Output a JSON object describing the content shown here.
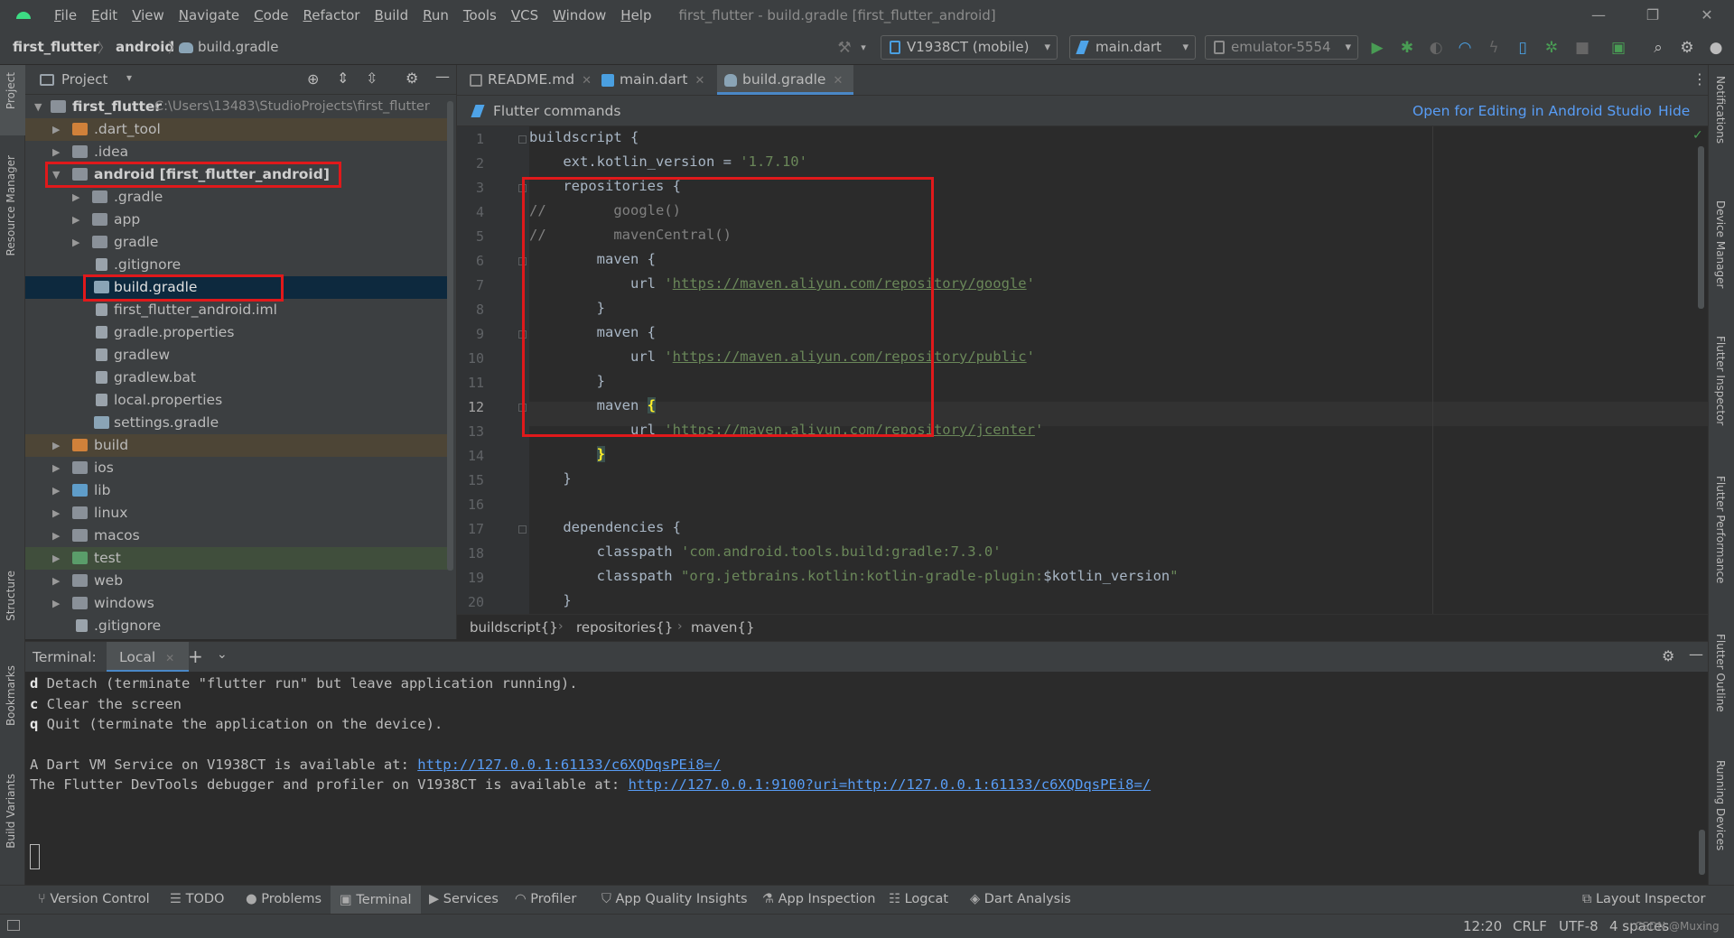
{
  "menubar": {
    "items": [
      "File",
      "Edit",
      "View",
      "Navigate",
      "Code",
      "Refactor",
      "Build",
      "Run",
      "Tools",
      "VCS",
      "Window",
      "Help"
    ],
    "window_title": "first_flutter - build.gradle [first_flutter_android]"
  },
  "navbar": {
    "breadcrumbs": [
      "first_flutter",
      "android",
      "build.gradle"
    ],
    "device": "V1938CT (mobile)",
    "run_config": "main.dart",
    "emulator": "emulator-5554"
  },
  "left_strip": {
    "tabs": [
      "Project",
      "Resource Manager",
      "Structure",
      "Bookmarks",
      "Build Variants"
    ]
  },
  "right_strip": {
    "tabs": [
      "Notifications",
      "Device Manager",
      "Flutter Inspector",
      "Flutter Performance",
      "Flutter Outline",
      "Running Devices"
    ]
  },
  "project": {
    "title": "Project",
    "root_name": "first_flutter",
    "root_path": "C:\\Users\\13483\\StudioProjects\\first_flutter",
    "rows": [
      {
        "label": ".dart_tool"
      },
      {
        "label": ".idea"
      },
      {
        "label": "android [first_flutter_android]"
      },
      {
        "label": ".gradle"
      },
      {
        "label": "app"
      },
      {
        "label": "gradle"
      },
      {
        "label": ".gitignore"
      },
      {
        "label": "build.gradle"
      },
      {
        "label": "first_flutter_android.iml"
      },
      {
        "label": "gradle.properties"
      },
      {
        "label": "gradlew"
      },
      {
        "label": "gradlew.bat"
      },
      {
        "label": "local.properties"
      },
      {
        "label": "settings.gradle"
      },
      {
        "label": "build"
      },
      {
        "label": "ios"
      },
      {
        "label": "lib"
      },
      {
        "label": "linux"
      },
      {
        "label": "macos"
      },
      {
        "label": "test"
      },
      {
        "label": "web"
      },
      {
        "label": "windows"
      },
      {
        "label": ".gitignore"
      }
    ]
  },
  "editor": {
    "tabs": [
      {
        "label": "README.md"
      },
      {
        "label": "main.dart"
      },
      {
        "label": "build.gradle"
      }
    ],
    "banner": {
      "text": "Flutter commands",
      "open_link": "Open for Editing in Android Studio",
      "hide_link": "Hide"
    },
    "line_numbers": [
      "1",
      "2",
      "3",
      "4",
      "5",
      "6",
      "7",
      "8",
      "9",
      "10",
      "11",
      "12",
      "13",
      "14",
      "15",
      "16",
      "17",
      "18",
      "19",
      "20"
    ],
    "current_line": "12",
    "code": {
      "l1": "buildscript {",
      "l2_a": "    ext.kotlin_version = ",
      "l2_b": "'1.7.10'",
      "l3": "    repositories {",
      "l4": "//        google()",
      "l5": "//        mavenCentral()",
      "l6": "        maven {",
      "l7_a": "            url ",
      "l7_url": "https://maven.aliyun.com/repository/google",
      "l8": "        }",
      "l9": "        maven {",
      "l10_url": "https://maven.aliyun.com/repository/public",
      "l11": "        }",
      "l12": "        maven ",
      "l13_url": "https://maven.aliyun.com/repository/jcenter",
      "l14": "        ",
      "l15": "    }",
      "l17": "    dependencies {",
      "l18_a": "        classpath ",
      "l18_b": "'com.android.tools.build:gradle:7.3.0'",
      "l19_a": "        classpath ",
      "l19_b": "\"org.jetbrains.kotlin:kotlin-gradle-plugin:",
      "l19_c": "$kotlin_version",
      "l19_d": "\"",
      "l20": "    }",
      "quote": "'",
      "open_brace": "{",
      "close_brace": "}"
    },
    "breadcrumbs": [
      "buildscript{}",
      "repositories{}",
      "maven{}"
    ]
  },
  "terminal": {
    "label": "Terminal:",
    "tab": "Local",
    "lines": [
      {
        "key": "d",
        "text": " Detach (terminate \"flutter run\" but leave application running)."
      },
      {
        "key": "c",
        "text": " Clear the screen"
      },
      {
        "key": "q",
        "text": " Quit (terminate the application on the device)."
      }
    ],
    "vm_text": "A Dart VM Service on V1938CT is available at: ",
    "vm_link": "http://127.0.0.1:61133/c6XQDqsPEi8=/",
    "devtools_text": "The Flutter DevTools debugger and profiler on V1938CT is available at: ",
    "devtools_link": "http://127.0.0.1:9100?uri=http://127.0.0.1:61133/c6XQDqsPEi8=/"
  },
  "bottom_tools": [
    "Version Control",
    "TODO",
    "Problems",
    "Terminal",
    "Services",
    "Profiler",
    "App Quality Insights",
    "App Inspection",
    "Logcat",
    "Dart Analysis",
    "Layout Inspector"
  ],
  "status": {
    "position": "12:20",
    "line_sep": "CRLF",
    "encoding": "UTF-8",
    "indent": "4 spaces",
    "watermark": "CSDN @Muxing"
  },
  "colors": {
    "accent": "#4a88c7",
    "annotation_box": "#e0191b",
    "link": "#589df6",
    "string": "#6a8759"
  }
}
